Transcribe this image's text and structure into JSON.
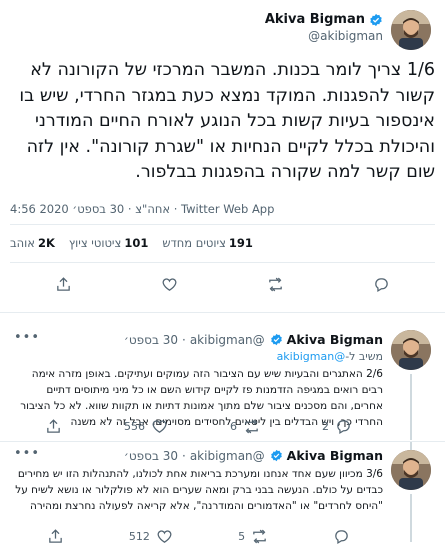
{
  "main_tweet": {
    "display_name": "Akiva Bigman",
    "handle": "@akibigman",
    "text": "1/6 צריך לומר בכנות. המשבר המרכזי של הקורונה לא קשור להפגנות. המוקד נמצא כעת במגזר החרדי, שיש בו אינספור בעיות קשות בכל הנוגע לאורח החיים המודרני והיכולת בכלל לקיים הנחיות או \"שגרת קורונה\". אין לזה שום קשר למה שקורה בהפגנות בבלפור.",
    "meta": "4:56 אחה\"צ · 30 בספט׳ 2020 · Twitter Web App",
    "stats": {
      "retweets_count": "191",
      "retweets_label": "ציוטים מחדש",
      "quotes_count": "101",
      "quotes_label": "ציטוטי ציוץ",
      "likes_count": "2K",
      "likes_label": "אוהב"
    }
  },
  "replies": [
    {
      "display_name": "Akiva Bigman",
      "handle": "@akibigman",
      "date": "30 בספט׳",
      "replying_prefix": "משיב ל-",
      "replying_handle": "@akibigman",
      "text": "2/6 האתגרים והבעיות שיש עם הציבור הזה עמוקים ועתיקים. באופן מזרה אימה רבים רואים במגיפה הזדמנות פז לקיים קידוש השם או כל מיני מיתוסים דתיים אחרים, והם מסכנים ציבור שלם מתוך אמונות דתיות או תקוות שווא. לא כל הציבור החרדי כך, ויש הבדלים בין ליטאים לחסידים מסוימים, אבל זה לא משנה",
      "like_count": "556",
      "retweet_count": "6",
      "reply_count": "2"
    },
    {
      "display_name": "Akiva Bigman",
      "handle": "@akibigman",
      "date": "30 בספט׳",
      "text": "3/6 מכיוון שעם אחד אנחנו ומערכת בריאות אחת לכולנו, להתנהלות הזו יש מחירים כבדים על כולם. הנעשה בבני ברק ומאה שערים הוא לא פולקלור או נושא לשיח על \"היחס לחרדים\" או \"האדמורים והמודרנה\", אלא קריאה לפעולה נחרצת ומהירה",
      "like_count": "512",
      "retweet_count": "5"
    }
  ],
  "colors": {
    "link": "#1d9bf0",
    "muted": "#536471",
    "divider": "#e6ecf0",
    "verified": "#1d9bf0"
  }
}
